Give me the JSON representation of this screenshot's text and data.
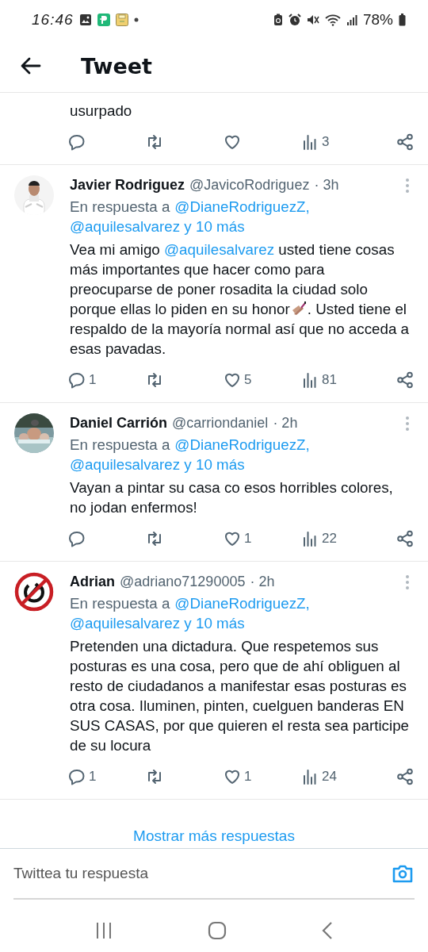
{
  "status_bar": {
    "time": "16:46",
    "battery": "78%"
  },
  "header": {
    "title": "Tweet"
  },
  "tweets": [
    {
      "kind": "partial",
      "body": [
        {
          "kind": "text",
          "text": "usurpado"
        }
      ],
      "actions": [
        {
          "kind": "reply"
        },
        {
          "kind": "retweet"
        },
        {
          "kind": "like"
        },
        {
          "kind": "views",
          "count": "3"
        },
        {
          "kind": "share"
        }
      ]
    },
    {
      "kind": "reply",
      "avatar": {
        "kind": "picture"
      },
      "name": "Javier Rodriguez",
      "handle": "@JavicoRodriguez",
      "time": "· 3h",
      "reply_prefix": "En respuesta a",
      "reply_to": [
        "@DianeRodriguezZ,",
        "@aquilesalvarez y 10 más"
      ],
      "body": [
        {
          "kind": "text",
          "text": "Vea mi amigo "
        },
        {
          "kind": "mention",
          "text": "@aquilesalvarez"
        },
        {
          "kind": "text",
          "text": " usted tiene cosas más importantes que hacer como para preocuparse de poner rosadita la ciudad solo porque ellas lo piden en su honor"
        },
        {
          "kind": "emoji"
        },
        {
          "kind": "text",
          "text": ". Usted tiene el respaldo de la mayoría normal así que no acceda a esas pavadas."
        }
      ],
      "actions": [
        {
          "kind": "reply",
          "count": "1"
        },
        {
          "kind": "retweet"
        },
        {
          "kind": "like",
          "count": "5"
        },
        {
          "kind": "views",
          "count": "81"
        },
        {
          "kind": "share"
        }
      ]
    },
    {
      "kind": "reply",
      "avatar": {
        "kind": "picture"
      },
      "name": "Daniel Carrión",
      "handle": "@carriondaniel",
      "time": "· 2h",
      "reply_prefix": "En respuesta a",
      "reply_to": [
        "@DianeRodriguezZ,",
        "@aquilesalvarez y 10 más"
      ],
      "body": [
        {
          "kind": "text",
          "text": "Vayan a pintar su casa co  esos horribles colores, no jodan enfermos!"
        }
      ],
      "actions": [
        {
          "kind": "reply"
        },
        {
          "kind": "retweet"
        },
        {
          "kind": "like",
          "count": "1"
        },
        {
          "kind": "views",
          "count": "22"
        },
        {
          "kind": "share"
        }
      ]
    },
    {
      "kind": "reply",
      "avatar": {
        "kind": "prohibited"
      },
      "name": "Adrian",
      "handle": "@adriano71290005",
      "time": "· 2h",
      "reply_prefix": "En respuesta a",
      "reply_to": [
        "@DianeRodriguezZ,",
        "@aquilesalvarez y 10 más"
      ],
      "body": [
        {
          "kind": "text",
          "text": "Pretenden una dictadura. Que respetemos sus posturas es una cosa, pero que de ahí obliguen al resto de ciudadanos a manifestar esas posturas es otra cosa. Iluminen, pinten, cuelguen banderas EN SUS CASAS, por que quieren el resta sea participe de su locura"
        }
      ],
      "actions": [
        {
          "kind": "reply",
          "count": "1"
        },
        {
          "kind": "retweet"
        },
        {
          "kind": "like",
          "count": "1"
        },
        {
          "kind": "views",
          "count": "24"
        },
        {
          "kind": "share"
        }
      ]
    }
  ],
  "more_replies": "Mostrar más respuestas",
  "compose": {
    "placeholder": "Twittea tu respuesta"
  }
}
